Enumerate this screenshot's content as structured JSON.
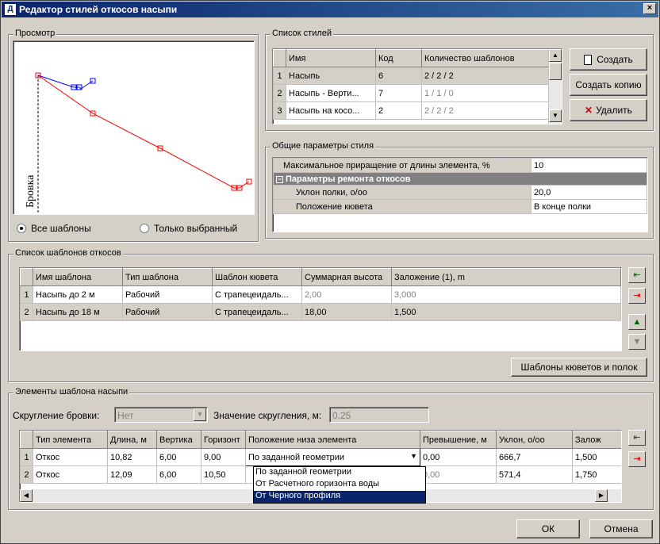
{
  "window": {
    "title": "Редактор стилей откосов насыпи",
    "icon_letter": "Д",
    "close_label": "×"
  },
  "preview": {
    "group_title": "Просмотр",
    "axis_label": "Бровка",
    "radio_all": "Все шаблоны",
    "radio_selected": "Только выбранный",
    "radio_all_checked": true
  },
  "styles": {
    "group_title": "Список стилей",
    "columns": [
      "Имя",
      "Код",
      "Количество шаблонов"
    ],
    "rows": [
      {
        "num": "1",
        "name": "Насыпь",
        "code": "6",
        "count": "2 / 2 / 2"
      },
      {
        "num": "2",
        "name": "Насыпь - Верти...",
        "code": "7",
        "count": "1 / 1 / 0"
      },
      {
        "num": "3",
        "name": "Насыпь на косо...",
        "code": "2",
        "count": "2 / 2 / 2"
      }
    ],
    "create_label": "Создать",
    "copy_label": "Создать копию",
    "delete_label": "Удалить"
  },
  "params": {
    "group_title": "Общие параметры стиля",
    "rows": [
      {
        "name": "Максимальное приращение от длины элемента, %",
        "value": "10"
      },
      {
        "name": "Параметры ремонта откосов",
        "value": "",
        "section": true
      },
      {
        "name": "Уклон полки, о/оо",
        "value": "20,0"
      },
      {
        "name": "Положение кювета",
        "value": "В конце полки"
      }
    ]
  },
  "templates": {
    "group_title": "Список шаблонов откосов",
    "columns": [
      "Имя шаблона",
      "Тип шаблона",
      "Шаблон кювета",
      "Суммарная высота",
      "Заложение (1), m"
    ],
    "rows": [
      {
        "num": "1",
        "name": "Насыпь до 2 м",
        "type": "Рабочий",
        "ditch": "С трапецеидаль...",
        "height": "2,00",
        "lay": "3,000",
        "gray": true
      },
      {
        "num": "2",
        "name": "Насыпь до 18 м",
        "type": "Рабочий",
        "ditch": "С трапецеидаль...",
        "height": "18,00",
        "lay": "1,500",
        "gray": false
      }
    ],
    "ditch_button": "Шаблоны кюветов и полок"
  },
  "elements": {
    "group_title": "Элементы шаблона насыпи",
    "rounding_label": "Скругление бровки:",
    "rounding_value": "Нет",
    "rounding_amount_label": "Значение скругления, м:",
    "rounding_amount_value": "0.25",
    "columns": [
      "Тип элемента",
      "Длина, м",
      "Вертика",
      "Горизонт",
      "Положение низа элемента",
      "Превышение, м",
      "Уклон, о/оо",
      "Залож"
    ],
    "rows": [
      {
        "num": "1",
        "type": "Откос",
        "length": "10,82",
        "vert": "6,00",
        "horiz": "9,00",
        "position": "По заданной геометрии",
        "excess": "0,00",
        "slope": "666,7",
        "lay": "1,500"
      },
      {
        "num": "2",
        "type": "Откос",
        "length": "12,09",
        "vert": "6,00",
        "horiz": "10,50",
        "position": "",
        "excess": "0,00",
        "slope": "571,4",
        "lay": "1,750"
      }
    ],
    "dropdown_options": [
      "По заданной геометрии",
      "От Расчетного горизонта воды",
      "От Черного профиля"
    ],
    "dropdown_selected_index": 2
  },
  "footer": {
    "ok_label": "ОК",
    "cancel_label": "Отмена"
  },
  "colors": {
    "accent": "#0a246a",
    "plot_red": "#ff0000",
    "plot_blue": "#0000ff",
    "selection": "#0a246a"
  }
}
